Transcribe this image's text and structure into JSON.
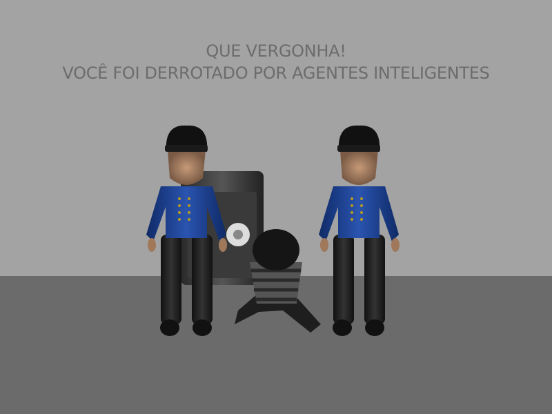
{
  "message": {
    "line1": "QUE VERGONHA!",
    "line2": "VOCÊ FOI DERROTADO POR AGENTES INTELIGENTES"
  },
  "colors": {
    "wall": "#a3a3a3",
    "floor": "#6b6b6b",
    "text": "#6c6c6c",
    "uniform": "#1e3f8a"
  }
}
